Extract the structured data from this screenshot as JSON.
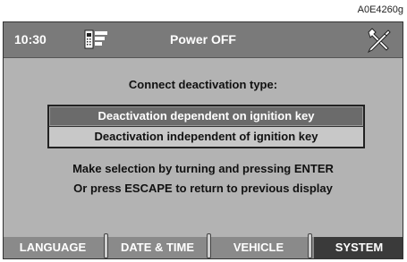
{
  "reference_code": "A0E4260g",
  "header": {
    "time": "10:30",
    "title": "Power OFF",
    "left_icon": "phone-menu-icon",
    "right_icon": "tools-icon"
  },
  "prompt": "Connect deactivation type:",
  "options": [
    {
      "label": "Deactivation dependent on ignition key",
      "selected": true
    },
    {
      "label": "Deactivation independent of ignition key",
      "selected": false
    }
  ],
  "instructions": {
    "line1": "Make selection by turning and pressing ENTER",
    "line2": "Or press ESCAPE to return to previous display"
  },
  "tabs": [
    {
      "label": "LANGUAGE",
      "active": false
    },
    {
      "label": "DATE & TIME",
      "active": false
    },
    {
      "label": "VEHICLE",
      "active": false
    },
    {
      "label": "SYSTEM",
      "active": true
    }
  ]
}
